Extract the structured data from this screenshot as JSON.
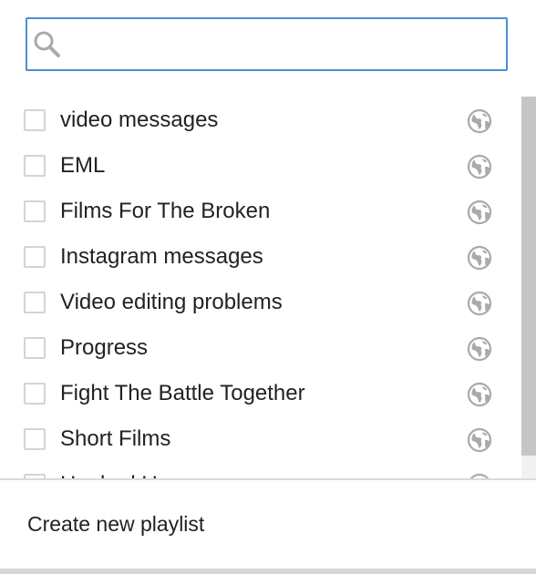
{
  "search": {
    "value": "",
    "placeholder": ""
  },
  "playlists": [
    {
      "label": "video messages",
      "privacy_icon": "globe-icon"
    },
    {
      "label": "EML",
      "privacy_icon": "globe-icon"
    },
    {
      "label": "Films For The Broken",
      "privacy_icon": "globe-icon"
    },
    {
      "label": "Instagram messages",
      "privacy_icon": "globe-icon"
    },
    {
      "label": "Video editing problems",
      "privacy_icon": "globe-icon"
    },
    {
      "label": "Progress",
      "privacy_icon": "globe-icon"
    },
    {
      "label": "Fight The Battle Together",
      "privacy_icon": "globe-icon"
    },
    {
      "label": "Short Films",
      "privacy_icon": "globe-icon"
    },
    {
      "label": "Hooked Up",
      "privacy_icon": "globe-icon"
    }
  ],
  "footer": {
    "create_label": "Create new playlist"
  },
  "colors": {
    "focus_border": "#4a90d4",
    "text": "#222222",
    "icon_gray": "#a9a9a9",
    "scroll_thumb": "#c6c6c6"
  }
}
